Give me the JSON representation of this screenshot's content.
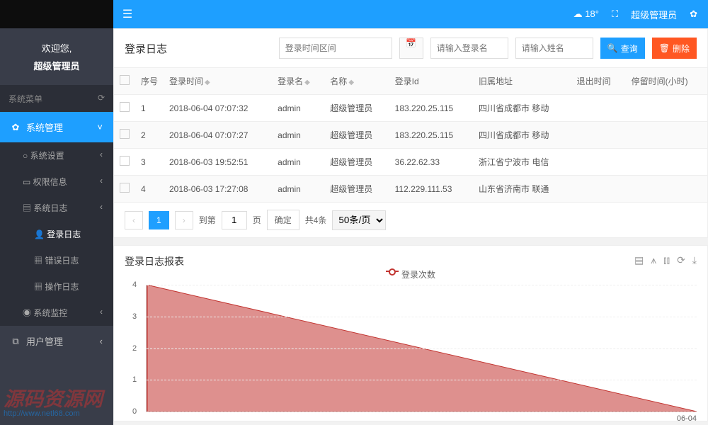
{
  "topbar": {
    "temperature": "18°",
    "username": "超级管理员"
  },
  "welcome": {
    "greeting": "欢迎您,",
    "role": "超级管理员"
  },
  "menu_header": "系统菜单",
  "menu": {
    "sys_manage": "系统管理",
    "sys_setting": "系统设置",
    "perm_info": "权限信息",
    "sys_log": "系统日志",
    "login_log": "登录日志",
    "error_log": "错误日志",
    "oper_log": "操作日志",
    "sys_monitor": "系统监控",
    "user_manage": "用户管理"
  },
  "panel": {
    "title": "登录日志",
    "date_placeholder": "登录时间区间",
    "login_placeholder": "请输入登录名",
    "name_placeholder": "请输入姓名",
    "search_btn": "查询",
    "delete_btn": "删除"
  },
  "table": {
    "headers": {
      "seq": "序号",
      "time": "登录时间",
      "login": "登录名",
      "name": "名称",
      "ip": "登录Id",
      "loc": "旧属地址",
      "logout": "退出时间",
      "stay": "停留时间(小时)"
    },
    "rows": [
      {
        "seq": "1",
        "time": "2018-06-04 07:07:32",
        "login": "admin",
        "name": "超级管理员",
        "ip": "183.220.25.115",
        "loc": "四川省成都市 移动",
        "logout": "",
        "stay": ""
      },
      {
        "seq": "2",
        "time": "2018-06-04 07:07:27",
        "login": "admin",
        "name": "超级管理员",
        "ip": "183.220.25.115",
        "loc": "四川省成都市 移动",
        "logout": "",
        "stay": ""
      },
      {
        "seq": "3",
        "time": "2018-06-03 19:52:51",
        "login": "admin",
        "name": "超级管理员",
        "ip": "36.22.62.33",
        "loc": "浙江省宁波市 电信",
        "logout": "",
        "stay": ""
      },
      {
        "seq": "4",
        "time": "2018-06-03 17:27:08",
        "login": "admin",
        "name": "超级管理员",
        "ip": "112.229.111.53",
        "loc": "山东省济南市 联通",
        "logout": "",
        "stay": ""
      }
    ]
  },
  "pager": {
    "page1": "1",
    "goto": "到第",
    "goto_val": "1",
    "page_unit": "页",
    "confirm": "确定",
    "total": "共4条",
    "pagesize": "50条/页"
  },
  "chart_panel_title": "登录日志报表",
  "chart_legend": "登录次数",
  "chart_data": {
    "type": "area",
    "xlabel": "",
    "ylabel": "",
    "ylim": [
      0,
      4
    ],
    "yticks": [
      0,
      1,
      2,
      3,
      4
    ],
    "x_categories": [
      "06-04"
    ],
    "series": [
      {
        "name": "登录次数",
        "color": "#c23531",
        "values": [
          4,
          0
        ]
      }
    ]
  },
  "watermark": {
    "main": "源码资源网",
    "sub": "http://www.netl68.com"
  }
}
